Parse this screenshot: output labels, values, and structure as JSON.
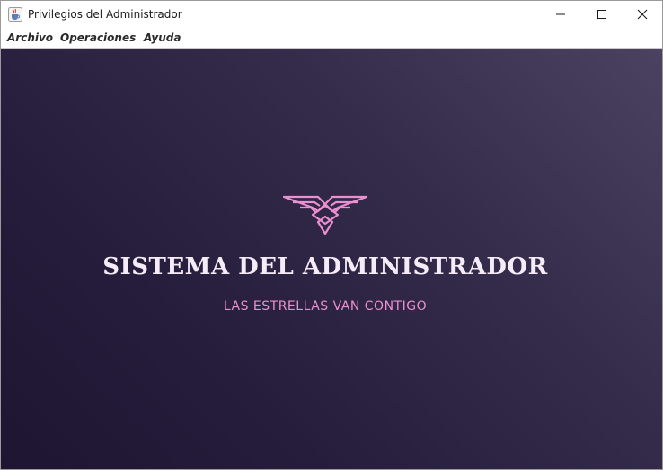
{
  "window": {
    "title": "Privilegios del Administrador",
    "icon": "java-cup-icon",
    "controls": [
      "minimize-icon",
      "maximize-icon",
      "close-icon"
    ]
  },
  "menubar": {
    "items": [
      {
        "label": "Archivo"
      },
      {
        "label": "Operaciones"
      },
      {
        "label": "Ayuda"
      }
    ]
  },
  "splash": {
    "logo_icon": "eagle-icon",
    "title": "SISTEMA DEL ADMINISTRADOR",
    "subtitle": "LAS ESTRELLAS VAN CONTIGO"
  },
  "colors": {
    "background_dark": "#1d1531",
    "background_light": "#4a4260",
    "title": "#f6ecf8",
    "accent": "#ea8fcf"
  }
}
